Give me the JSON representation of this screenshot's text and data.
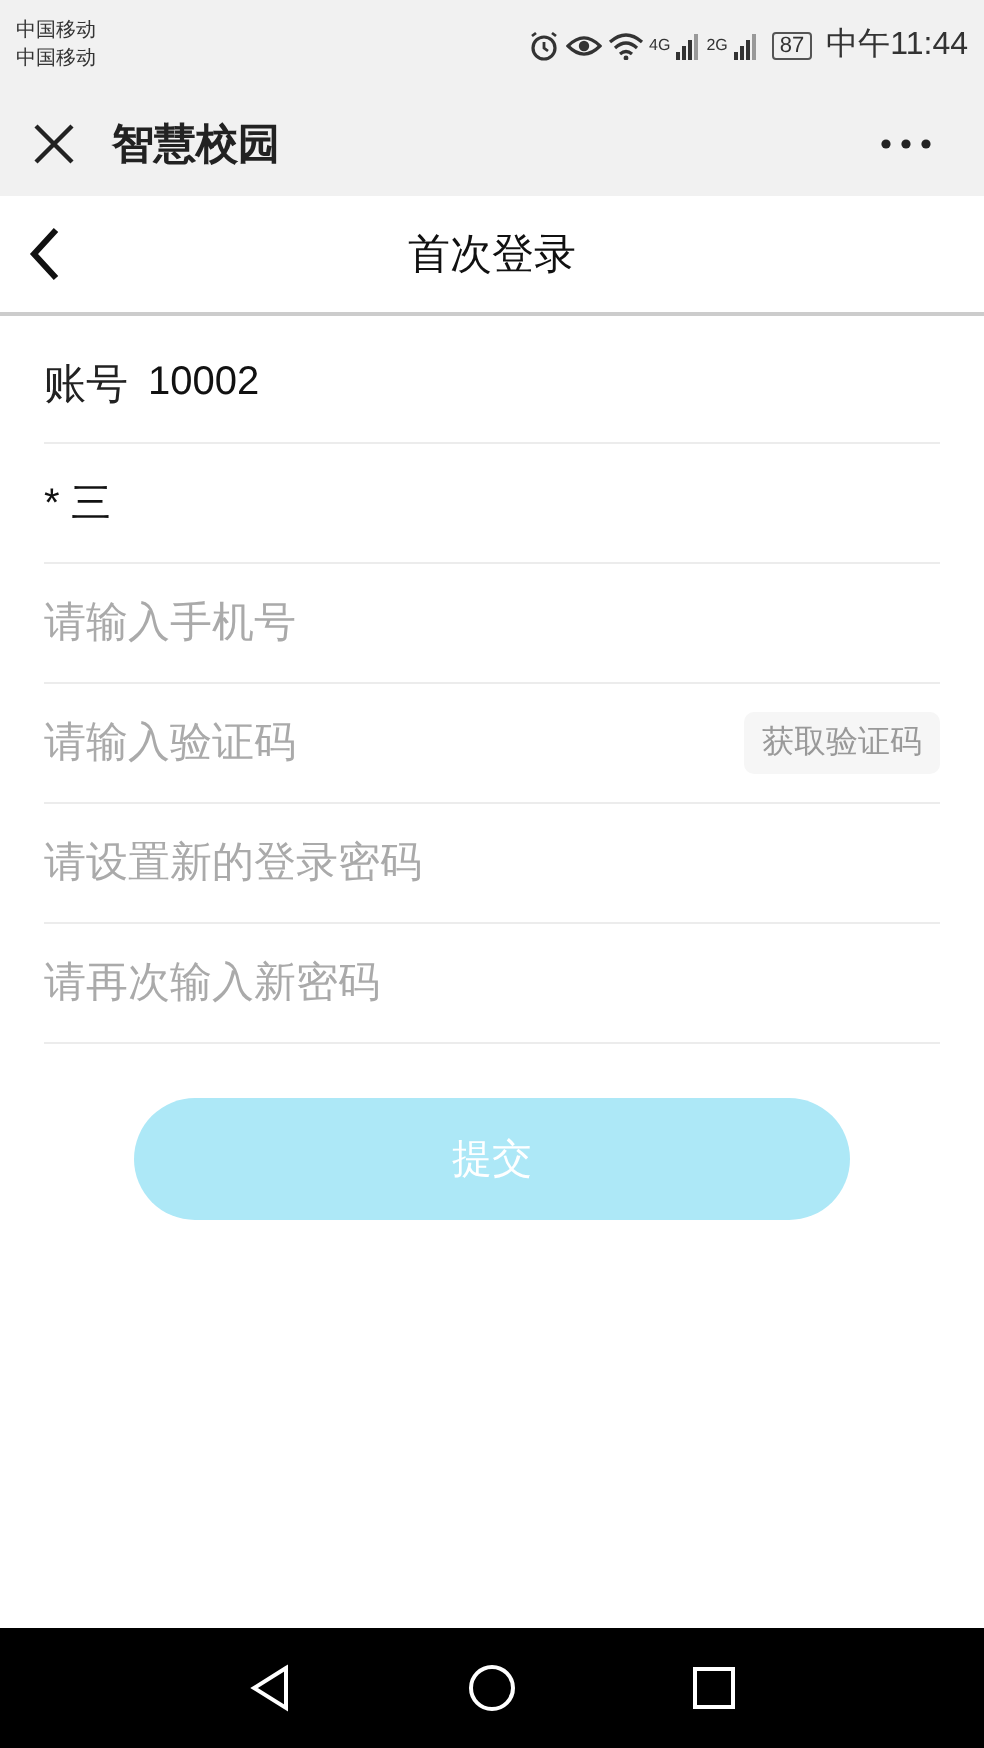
{
  "status_bar": {
    "carriers": [
      "中国移动",
      "中国移动"
    ],
    "network_labels": [
      "4G",
      "2G"
    ],
    "battery": "87",
    "time": "中午11:44"
  },
  "app_bar": {
    "title": "智慧校园"
  },
  "page": {
    "title": "首次登录"
  },
  "fields": [
    {
      "kind": "static",
      "label": "账号",
      "value": "10002"
    },
    {
      "kind": "static",
      "value": "* 三"
    },
    {
      "kind": "input",
      "placeholder": "请输入手机号"
    },
    {
      "kind": "code",
      "placeholder": "请输入验证码",
      "button": "获取验证码"
    },
    {
      "kind": "input",
      "placeholder": "请设置新的登录密码"
    },
    {
      "kind": "input",
      "placeholder": "请再次输入新密码"
    }
  ],
  "submit": {
    "label": "提交",
    "disabled": true
  }
}
